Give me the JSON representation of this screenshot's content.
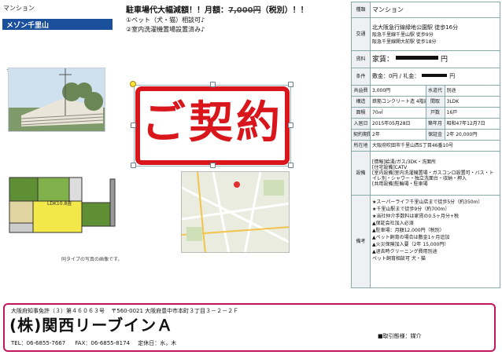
{
  "left": {
    "type_label": "マンション",
    "name": "メゾン千里山",
    "headline": "駐車場代大幅減額！！月額：",
    "old_price": "7,000円",
    "tax_note": "（税別）！！",
    "feature1": "①ペット（犬・猫）相談可♪",
    "feature2": "②室内洗濯機置場設置済み♪",
    "stamp": "ご契約",
    "plan_room_label": "LDK10.8畳",
    "plan_caption": "同タイプの写真の画像です。"
  },
  "details": {
    "row1": {
      "label": "種類",
      "value": "マンション"
    },
    "access": {
      "label": "交通",
      "line1": "北大阪急行線緑地公園駅 徒歩16分",
      "line2": "阪急千里線千里山駅 徒歩9分",
      "line3": "阪急千里線関大前駅 徒歩18分"
    },
    "rent": {
      "label": "賃料",
      "value": "家賃：",
      "unit": "円"
    },
    "terms": {
      "label": "条件",
      "value": "敷金：0円 / 礼金：",
      "unit": "円"
    },
    "fee": {
      "label": "共益費",
      "value": "3,000円",
      "label2": "水道代",
      "value2": "別途"
    },
    "structure": {
      "label": "構造",
      "value": "鉄筋コンクリート造 4階建",
      "label2": "間取",
      "value2": "3LDK"
    },
    "area": {
      "label": "面積",
      "value": "70㎡",
      "label2": "戸数",
      "value2": "16戸"
    },
    "movein": {
      "label": "入居日",
      "value": "2015年05月28日",
      "label2": "築年月",
      "value2": "昭和47年12月7日"
    },
    "contract": {
      "label": "契約期間",
      "value": "2年",
      "label2": "保証金",
      "value2": "2年 20,000円"
    },
    "address": {
      "label": "所在地",
      "value": "大阪府吹田市千里山西5丁目46番10号"
    },
    "equipment": {
      "label": "設備",
      "lines": [
        "[情報]給湯/ガス/3DK・洗面所",
        "[住宅設備]CATV",
        "[室内設備]室内洗濯機置場・ガスコンロ設置可・バス・トイレ別・シャワー・独立洗面台・収納・押入",
        "[共用設備]駐輪場・駐車場"
      ]
    },
    "remarks": {
      "label": "備考",
      "lines": [
        "★スーパーライフ千里山店まで徒歩5分（約350m）",
        "★千里山駅まで徒歩9分（約700m）",
        "★当社仲介手数料は家賃の0.5ヶ月分+税",
        "▲保証会社加入必須",
        "▲駐車場：月額12,000円（税別）",
        "▲ペット飼育の場合は敷金1ヶ月追加",
        "▲火災保険加入要（2年 15,000円）",
        "▲退去時クリーニング費用別途",
        "ペット飼育相談可 犬・猫"
      ]
    }
  },
  "company": {
    "license": "大阪府知事免許（３）第４６０６３号",
    "address": "〒560-0021 大阪府豊中市本町３丁目３－２－２Ｆ",
    "name": "(株)関西リーブインＡ",
    "tel": "TEL：06-6855-7667",
    "fax": "FAX：06-6855-8174",
    "holiday": "定休日：水，木",
    "deal_type": "■取引態様：媒介"
  },
  "colors": {
    "accent_blue": "#1a4f9c",
    "stamp_red": "#d8161b",
    "footer_border": "#c2185b"
  }
}
